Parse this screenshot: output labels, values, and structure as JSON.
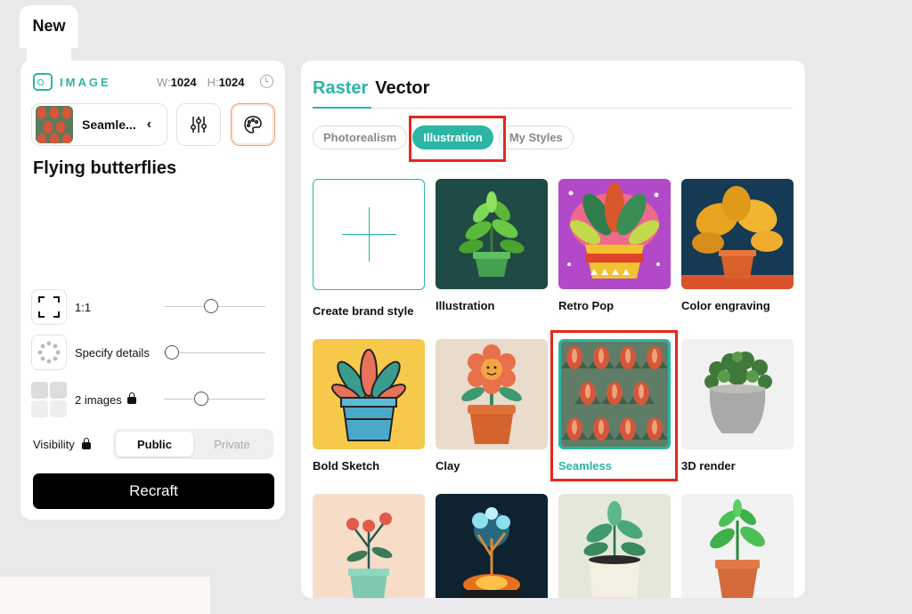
{
  "tab_new": "New",
  "left": {
    "section_label": "IMAGE",
    "width_label": "W:",
    "width_value": "1024",
    "height_label": "H:",
    "height_value": "1024",
    "style_name": "Seamle...",
    "prompt": "Flying butterflies",
    "aspect_label": "1:1",
    "details_label": "Specify details",
    "images_label": "2 images",
    "visibility_label": "Visibility",
    "visibility_options": [
      "Public",
      "Private"
    ],
    "recraft_label": "Recraft"
  },
  "right": {
    "tabs": [
      "Raster",
      "Vector"
    ],
    "chips": [
      "Photorealism",
      "Illustration",
      "My Styles"
    ],
    "cards": [
      "Create brand style",
      "Illustration",
      "Retro Pop",
      "Color engraving",
      "Bold Sketch",
      "Clay",
      "Seamless",
      "3D render"
    ]
  },
  "colors": {
    "accent": "#2bb5a5",
    "highlight": "#e8271b"
  },
  "icons": [
    "image-icon",
    "clock-icon",
    "chevron-left-icon",
    "sliders-icon",
    "palette-icon",
    "aspect-ratio-icon",
    "dots-circle-icon",
    "grid-icon",
    "lock-icon",
    "plus-icon"
  ]
}
